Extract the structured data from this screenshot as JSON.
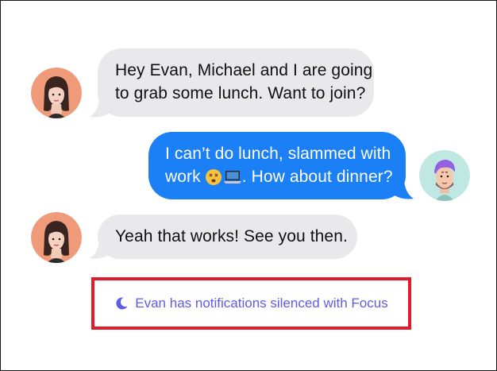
{
  "conversation": {
    "messages": [
      {
        "sender": "contact",
        "lines": [
          "Hey Evan, Michael and I are going",
          "to grab some lunch. Want to join?"
        ]
      },
      {
        "sender": "me",
        "lines": [
          "I can’t do lunch, slammed with",
          "work",
          ". How about dinner?"
        ],
        "emoji": [
          "dizzy-face-emoji",
          "laptop-emoji"
        ]
      },
      {
        "sender": "contact",
        "lines": [
          "Yeah that works! See you then."
        ]
      }
    ]
  },
  "focus_notice": {
    "icon": "moon-icon",
    "text": "Evan has notifications silenced with Focus",
    "color": "#5e5ce6",
    "highlight_color": "#e21b2b"
  },
  "colors": {
    "outgoing_bubble": "#1b7ff5",
    "incoming_bubble": "#e9e9eb"
  }
}
